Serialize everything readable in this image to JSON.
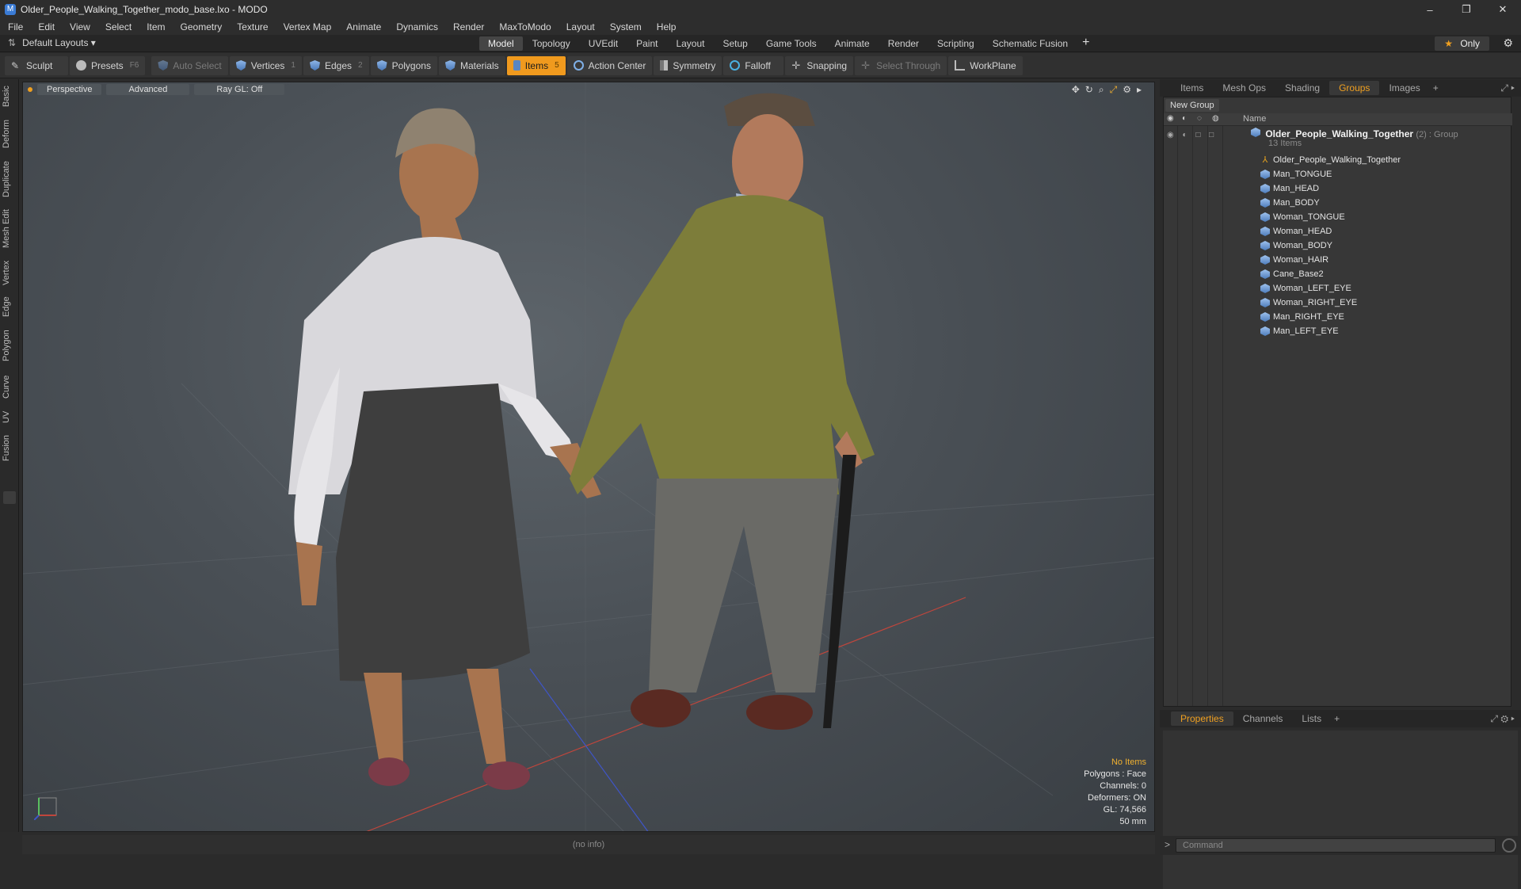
{
  "window": {
    "title": "Older_People_Walking_Together_modo_base.lxo - MODO",
    "controls": [
      "–",
      "❐",
      "✕"
    ]
  },
  "menu": [
    "File",
    "Edit",
    "View",
    "Select",
    "Item",
    "Geometry",
    "Texture",
    "Vertex Map",
    "Animate",
    "Dynamics",
    "Render",
    "MaxToModo",
    "Layout",
    "System",
    "Help"
  ],
  "layouts": {
    "label": "Default Layouts ▾",
    "tabs": [
      "Model",
      "Topology",
      "UVEdit",
      "Paint",
      "Layout",
      "Setup",
      "Game Tools",
      "Animate",
      "Render",
      "Scripting",
      "Schematic Fusion"
    ],
    "active_tab": "Model",
    "plus": "+",
    "only_label": "Only",
    "star": "★"
  },
  "toolbar": {
    "sculpt": "Sculpt",
    "presets": "Presets",
    "presets_key": "F6",
    "auto_select": "Auto Select",
    "vertices": "Vertices",
    "vertices_key": "1",
    "edges": "Edges",
    "edges_key": "2",
    "polygons": "Polygons",
    "materials": "Materials",
    "items": "Items",
    "items_key": "5",
    "action_center": "Action Center",
    "symmetry": "Symmetry",
    "falloff": "Falloff",
    "snapping": "Snapping",
    "select_through": "Select Through",
    "workplane": "WorkPlane"
  },
  "left_tabs": [
    "Basic",
    "Deform",
    "Duplicate",
    "Mesh Edit",
    "Vertex",
    "Edge",
    "Polygon",
    "Curve",
    "UV",
    "Fusion"
  ],
  "viewport": {
    "perspective": "Perspective",
    "advanced": "Advanced",
    "raygl": "Ray GL: Off",
    "info": {
      "no_items": "No Items",
      "polygons": "Polygons : Face",
      "channels": "Channels: 0",
      "deformers": "Deformers: ON",
      "gl": "GL: 74,566",
      "focal": "50 mm"
    }
  },
  "status": "(no info)",
  "panel_tabs": [
    "Items",
    "Mesh Ops",
    "Shading",
    "Groups",
    "Images"
  ],
  "panel_active": "Groups",
  "groups": {
    "new_group": "New Group",
    "col_name": "Name",
    "root_name": "Older_People_Walking_Together",
    "root_count": "(2) : Group",
    "root_sub": "13 Items",
    "items": [
      {
        "name": "Older_People_Walking_Together",
        "icon": "locator-icon"
      },
      {
        "name": "Man_TONGUE",
        "icon": "mesh-icon"
      },
      {
        "name": "Man_HEAD",
        "icon": "mesh-icon"
      },
      {
        "name": "Man_BODY",
        "icon": "mesh-icon"
      },
      {
        "name": "Woman_TONGUE",
        "icon": "mesh-icon"
      },
      {
        "name": "Woman_HEAD",
        "icon": "mesh-icon"
      },
      {
        "name": "Woman_BODY",
        "icon": "mesh-icon"
      },
      {
        "name": "Woman_HAIR",
        "icon": "mesh-icon"
      },
      {
        "name": "Cane_Base2",
        "icon": "mesh-icon"
      },
      {
        "name": "Woman_LEFT_EYE",
        "icon": "mesh-icon"
      },
      {
        "name": "Woman_RIGHT_EYE",
        "icon": "mesh-icon"
      },
      {
        "name": "Man_RIGHT_EYE",
        "icon": "mesh-icon"
      },
      {
        "name": "Man_LEFT_EYE",
        "icon": "mesh-icon"
      }
    ]
  },
  "props_tabs": [
    "Properties",
    "Channels",
    "Lists"
  ],
  "props_active": "Properties",
  "command_placeholder": "Command",
  "colors": {
    "accent": "#f09a1e",
    "viewport_bg": "#4a5056"
  }
}
